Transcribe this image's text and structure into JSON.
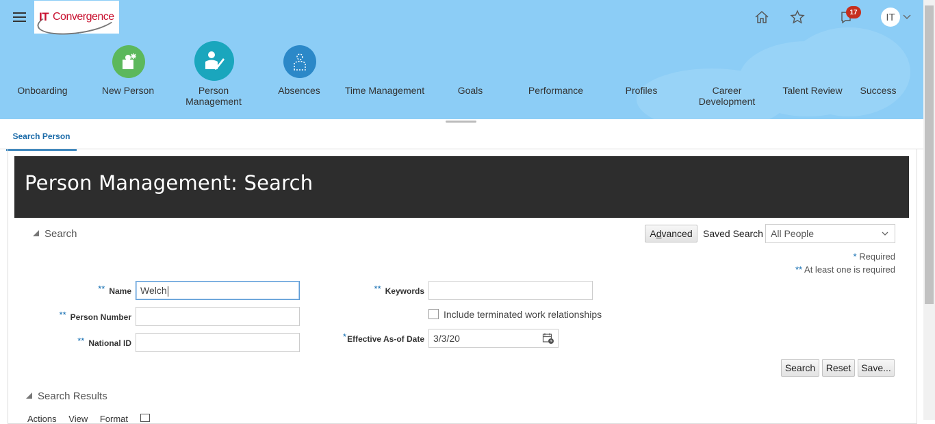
{
  "header": {
    "logo_text_it": "IT",
    "logo_text_rest": "Convergence",
    "notifications_count": "17",
    "avatar_initials": "IT"
  },
  "nav": {
    "items": [
      {
        "label": "Onboarding"
      },
      {
        "label": "New Person"
      },
      {
        "label": "Person Management"
      },
      {
        "label": "Absences"
      },
      {
        "label": "Time Management"
      },
      {
        "label": "Goals"
      },
      {
        "label": "Performance"
      },
      {
        "label": "Profiles"
      },
      {
        "label": "Career Development"
      },
      {
        "label": "Talent Review"
      },
      {
        "label": "Success"
      }
    ],
    "icon_colors": {
      "new_person": "#5cb85c",
      "person_management": "#1aa6bd",
      "absences": "#2b88c8"
    }
  },
  "tabs": {
    "search_person": "Search Person"
  },
  "page": {
    "title": "Person Management: Search"
  },
  "search": {
    "section_label": "Search",
    "advanced_prefix": "A",
    "advanced_underline": "d",
    "advanced_rest": "vanced",
    "saved_search_label": "Saved Search",
    "saved_search_value": "All People",
    "required_note": "Required",
    "at_least_one_note": "At least one is required",
    "star_single": "*",
    "star_double": "**",
    "fields": {
      "name_label": "Name",
      "name_value": "Welch",
      "person_number_label": "Person Number",
      "person_number_value": "",
      "national_id_label": "National ID",
      "national_id_value": "",
      "keywords_label": "Keywords",
      "keywords_value": "",
      "include_terminated_label": "Include terminated work relationships",
      "include_terminated_checked": false,
      "effective_date_label": "Effective As-of Date",
      "effective_date_value": "3/3/20"
    },
    "buttons": {
      "search": "Search",
      "reset": "Reset",
      "save": "Save..."
    }
  },
  "results": {
    "section_label": "Search Results",
    "toolbar_actions": "Actions",
    "toolbar_view": "View",
    "toolbar_format": "Format"
  }
}
